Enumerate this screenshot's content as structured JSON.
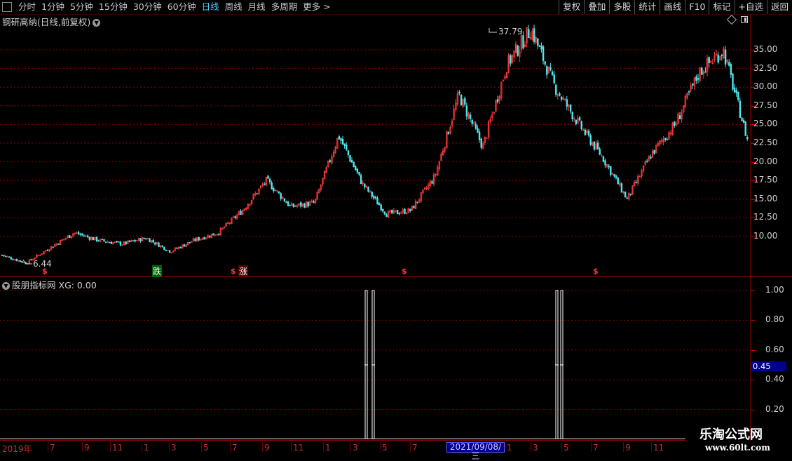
{
  "toolbar": {
    "periods": [
      "分时",
      "1分钟",
      "5分钟",
      "15分钟",
      "30分钟",
      "60分钟",
      "日线",
      "周线",
      "月线",
      "多周期",
      "更多 >"
    ],
    "active_period": "日线",
    "tools": [
      "复权",
      "叠加",
      "多股",
      "统计",
      "画线",
      "F10",
      "标记",
      "+自选",
      "返回"
    ]
  },
  "main_chart": {
    "title": "钢研高纳(日线,前复权)",
    "high_label": "37.79",
    "low_label": "6.44",
    "signals": [
      {
        "type": "s",
        "label": "$"
      },
      {
        "type": "down",
        "label": "跌"
      },
      {
        "type": "s",
        "label": "$"
      },
      {
        "type": "up",
        "label": "涨"
      },
      {
        "type": "s",
        "label": "$"
      },
      {
        "type": "s",
        "label": "$"
      }
    ]
  },
  "indicator": {
    "title": "股朋指标网",
    "value_label": "XG: 0.00",
    "cursor_value": "0.45"
  },
  "date_axis": {
    "labels": [
      "2019年",
      "7",
      "9",
      "11",
      "1",
      "3",
      "5",
      "7",
      "9",
      "11",
      "1",
      "3",
      "5",
      "7",
      "1",
      "3",
      "5",
      "7",
      "9",
      "11"
    ],
    "cursor_date": "2021/09/08/三"
  },
  "watermark": {
    "title": "乐淘公式网",
    "url": "www.60lt.com"
  },
  "colors": {
    "up": "#ff3b3b",
    "down": "#4ee8ee",
    "grid": "#8b0000",
    "accent": "#4ec9ff",
    "cursor_bg": "#00008e"
  },
  "chart_data": [
    {
      "type": "candlestick",
      "title": "钢研高纳(日线,前复权)",
      "yticks": [
        10.0,
        12.5,
        15.0,
        17.5,
        20.0,
        22.5,
        25.0,
        27.5,
        30.0,
        32.5,
        35.0
      ],
      "ytick_labels": [
        "10.00",
        "12.50",
        "15.00",
        "17.50",
        "20.00",
        "22.50",
        "25.00",
        "27.50",
        "30.00",
        "32.50",
        "35.00"
      ],
      "ylim": [
        5.0,
        39.0
      ],
      "x": [
        "2019-01",
        "2019-03",
        "2019-05",
        "2019-07",
        "2019-09",
        "2019-11",
        "2020-01",
        "2020-02",
        "2020-04",
        "2020-06",
        "2020-07",
        "2020-08",
        "2020-10",
        "2020-12",
        "2021-01",
        "2021-02",
        "2021-04",
        "2021-05",
        "2021-07",
        "2021-08",
        "2021-09",
        "2021-10",
        "2021-12",
        "2022-01",
        "2022-03",
        "2022-04",
        "2022-05",
        "2022-06",
        "2022-08",
        "2022-09",
        "2022-10",
        "2022-12"
      ],
      "close": [
        7.5,
        6.44,
        8.5,
        10.5,
        9.5,
        9.0,
        9.8,
        8.0,
        9.5,
        10.5,
        13.5,
        17.5,
        14.0,
        14.5,
        23.5,
        17.0,
        13.0,
        13.5,
        18.0,
        29.0,
        22.0,
        33.0,
        37.79,
        30.0,
        25.0,
        20.5,
        15.0,
        21.0,
        25.0,
        32.0,
        35.0,
        23.0
      ],
      "high_marker": 37.79,
      "low_marker": 6.44
    },
    {
      "type": "step",
      "title": "股朋指标网",
      "series_label": "XG",
      "yticks": [
        0.2,
        0.4,
        0.6,
        0.8,
        1.0
      ],
      "ytick_labels": [
        "0.20",
        "0.40",
        "0.60",
        "0.80",
        "1.00"
      ],
      "ylim": [
        0.0,
        1.05
      ],
      "spikes": [
        {
          "x": "2021-03",
          "value": 1.0
        },
        {
          "x": "2021-03",
          "value": 1.0
        },
        {
          "x": "2022-05",
          "value": 1.0
        },
        {
          "x": "2022-05",
          "value": 1.0
        }
      ]
    }
  ]
}
